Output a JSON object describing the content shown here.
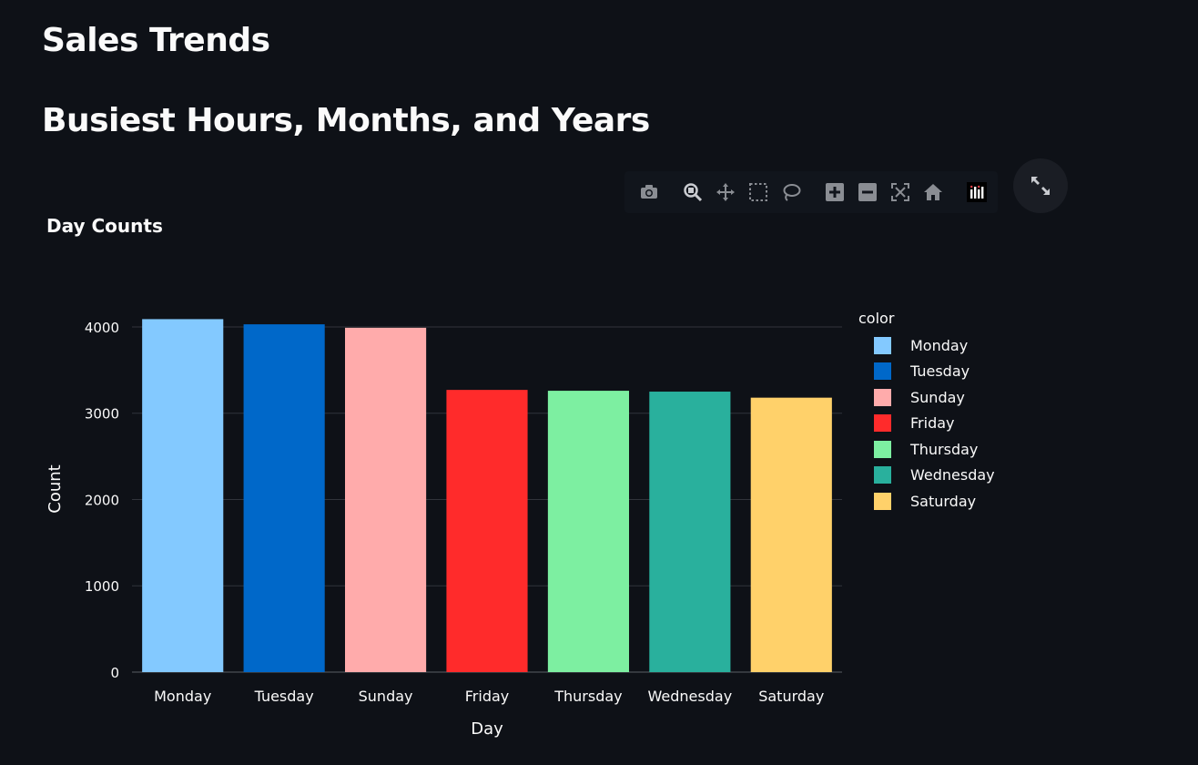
{
  "page": {
    "title": "Sales Trends",
    "subtitle": "Busiest Hours, Months, and Years"
  },
  "modebar": {
    "buttons": [
      {
        "name": "camera-icon"
      },
      {
        "name": "zoom-icon"
      },
      {
        "name": "pan-icon"
      },
      {
        "name": "box-select-icon"
      },
      {
        "name": "lasso-select-icon"
      },
      {
        "name": "zoom-in-icon"
      },
      {
        "name": "zoom-out-icon"
      },
      {
        "name": "autoscale-icon"
      },
      {
        "name": "reset-axes-icon"
      },
      {
        "name": "plotly-logo-icon"
      }
    ],
    "expand_icon": "expand-icon"
  },
  "chart_data": {
    "type": "bar",
    "title": "Day Counts",
    "xlabel": "Day",
    "ylabel": "Count",
    "ylim": [
      0,
      4200
    ],
    "yticks": [
      0,
      1000,
      2000,
      3000,
      4000
    ],
    "grid": true,
    "legend_title": "color",
    "legend_position": "right",
    "categories": [
      "Monday",
      "Tuesday",
      "Sunday",
      "Friday",
      "Thursday",
      "Wednesday",
      "Saturday"
    ],
    "values": [
      4090,
      4030,
      3990,
      3270,
      3260,
      3250,
      3180
    ],
    "colors": [
      "#83c9ff",
      "#0068c9",
      "#ffabab",
      "#ff2b2b",
      "#7defa1",
      "#29b09d",
      "#ffd16a"
    ]
  }
}
